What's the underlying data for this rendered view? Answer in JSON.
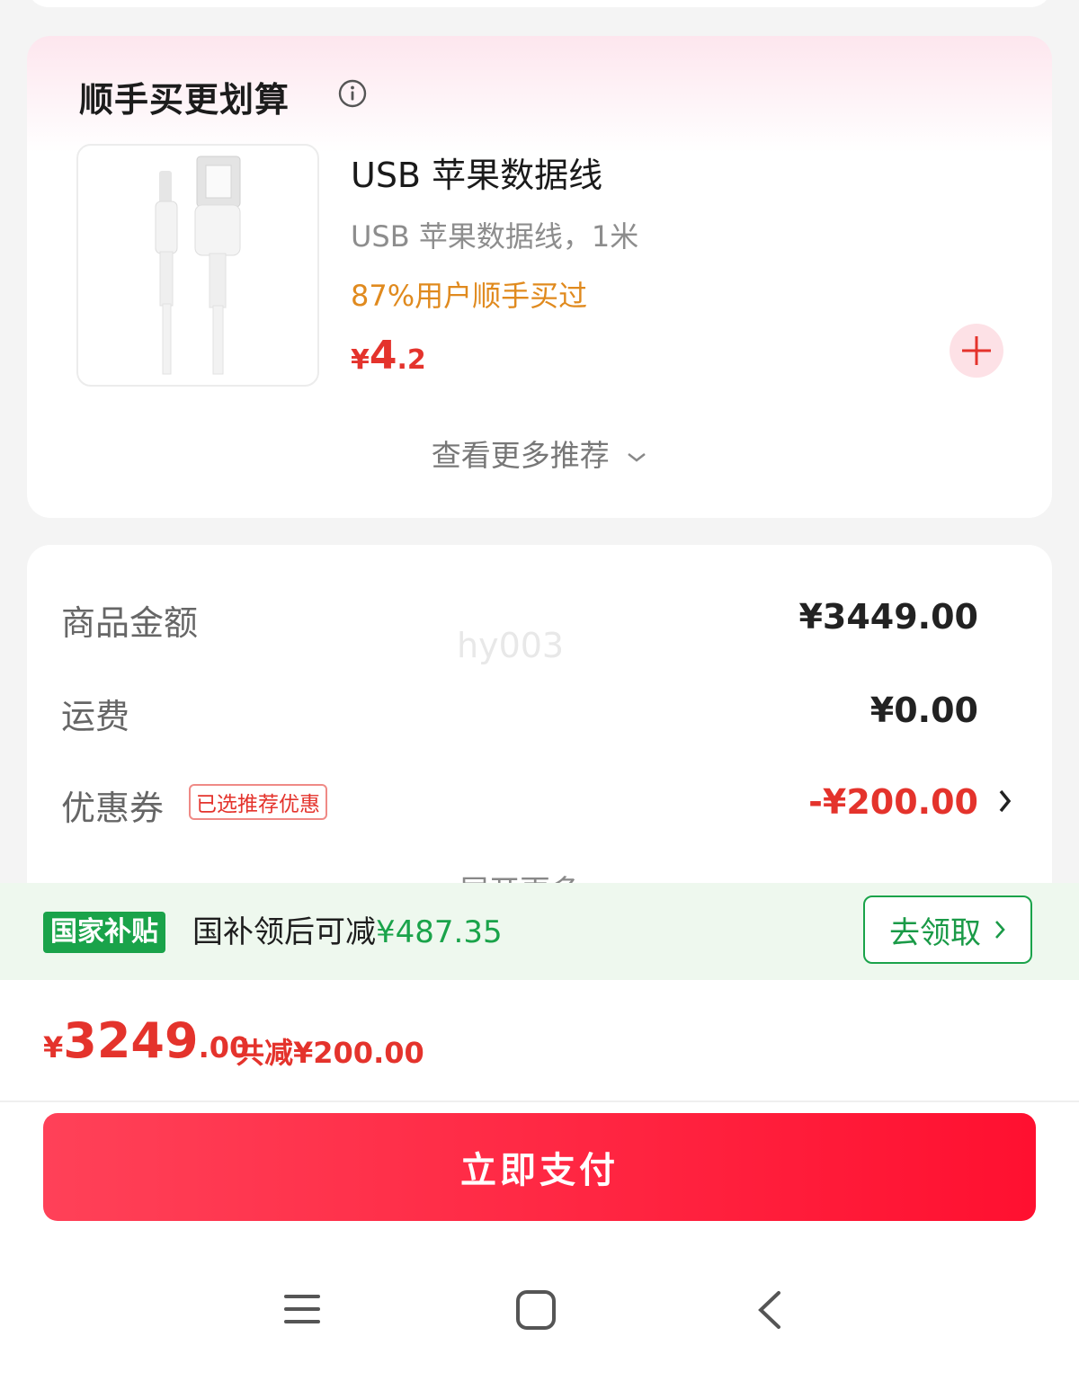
{
  "addon": {
    "title": "顺手买更划算",
    "product": {
      "name": "USB 苹果数据线",
      "desc": "USB 苹果数据线，1米",
      "tag": "87%用户顺手买过",
      "price_symbol": "¥",
      "price_int": "4",
      "price_dec": ".2"
    },
    "more_label": "查看更多推荐"
  },
  "summary": {
    "goods_label": "商品金额",
    "goods_value": "¥3449.00",
    "shipping_label": "运费",
    "shipping_value": "¥0.00",
    "coupon_label": "优惠券",
    "coupon_badge": "已选推荐优惠",
    "coupon_value": "-¥200.00",
    "expand_label": "展开更多",
    "watermark": "hy003"
  },
  "subsidy": {
    "tag": "国家补贴",
    "text": "国补领后可减",
    "amount": "¥487.35",
    "claim_label": "去领取"
  },
  "total": {
    "symbol": "¥",
    "int": "3249",
    "dec": ".00",
    "saved": "共减¥200.00"
  },
  "pay_label": "立即支付",
  "colors": {
    "accent_red": "#e4332c",
    "pay_button": "#ff1f3f",
    "subsidy_green": "#1aa34a",
    "tag_orange": "#e08a1e"
  },
  "icons": [
    "info-icon",
    "plus-icon",
    "chevron-down-icon",
    "chevron-right-icon",
    "menu-icon",
    "home-icon",
    "back-icon"
  ]
}
